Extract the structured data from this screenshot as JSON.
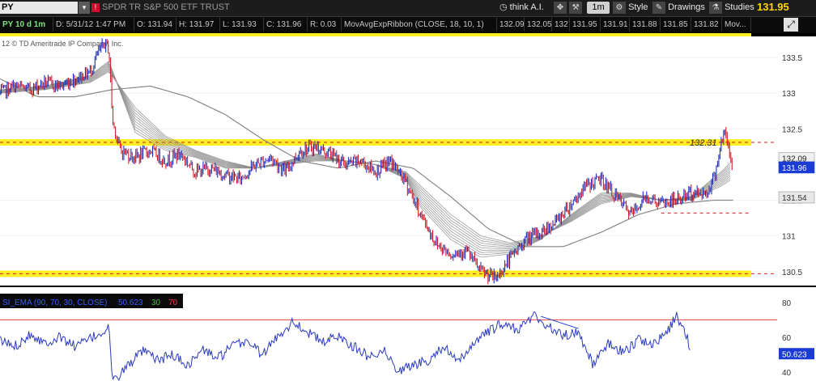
{
  "toolbar": {
    "symbol": "PY",
    "description": "SPDR TR S&P 500 ETF TRUST",
    "think_label": "think A.I.",
    "timeframe": "1m",
    "style_label": "Style",
    "drawings_label": "Drawings",
    "studies_label": "Studies",
    "last_price": "131.95"
  },
  "info": {
    "period": "PY 10 d 1m",
    "date": "D: 5/31/12 1:47 PM",
    "open": "O: 131.94",
    "high": "H: 131.97",
    "low": "L: 131.93",
    "close": "C: 131.96",
    "range": "R: 0.03",
    "study": "MovAvgExpRibbon (CLOSE, 18, 10, 1)",
    "ribbon_values": [
      "132.09",
      "132.05",
      "132",
      "131.95",
      "131.91",
      "131.88",
      "131.85",
      "131.82"
    ],
    "more": "Mov..."
  },
  "colors": {
    "background": "#000000",
    "price_panel": "#ffffff",
    "candle_up": "#1f2fb8",
    "candle_down": "#d21e2e",
    "ribbon": "#8c8c8c",
    "support_band": "#ffee22",
    "dashed_line": "#d22020",
    "rsi_line": "#2a3ac0",
    "rsi_bounds": "#e04040"
  },
  "chart_data": [
    {
      "type": "line",
      "panel": "price",
      "copyright": "12 © TD Ameritrade IP Company, Inc.",
      "ylim": [
        130.35,
        133.75
      ],
      "y_ticks": [
        133.5,
        133,
        132.5,
        131.5,
        131,
        130.5
      ],
      "y_tick_labels": [
        "133.5",
        "133",
        "132.5",
        "131.5",
        "131",
        "130.5"
      ],
      "annotation": "132.31",
      "right_labels": [
        "132.09",
        "131.96",
        "131.54"
      ],
      "levels": [
        {
          "name": "resistance",
          "y": 132.31,
          "style": "yellow-band"
        },
        {
          "name": "support",
          "y": 130.47,
          "style": "yellow-band"
        },
        {
          "name": "dash",
          "y": 131.32,
          "style": "dashed",
          "x_from": 0.88
        }
      ],
      "series": [
        {
          "kind": "price",
          "x": [
            0,
            0.02,
            0.04,
            0.06,
            0.08,
            0.1,
            0.12,
            0.13,
            0.14,
            0.145,
            0.15,
            0.16,
            0.18,
            0.2,
            0.22,
            0.24,
            0.26,
            0.28,
            0.3,
            0.32,
            0.34,
            0.36,
            0.38,
            0.4,
            0.42,
            0.44,
            0.46,
            0.48,
            0.5,
            0.52,
            0.54,
            0.56,
            0.58,
            0.6,
            0.62,
            0.64,
            0.66,
            0.68,
            0.7,
            0.72,
            0.74,
            0.76,
            0.78,
            0.8,
            0.82,
            0.84,
            0.86,
            0.88,
            0.9,
            0.92,
            0.94,
            0.95,
            0.96,
            0.965,
            0.97,
            0.975
          ],
          "y": [
            133.0,
            133.1,
            133.05,
            133.15,
            133.1,
            133.2,
            133.3,
            133.55,
            133.7,
            133.6,
            132.6,
            132.2,
            132.1,
            132.2,
            132.05,
            132.15,
            131.9,
            131.95,
            131.85,
            131.8,
            132.0,
            132.1,
            131.9,
            132.2,
            132.25,
            132.15,
            132.0,
            132.05,
            131.9,
            132.05,
            131.75,
            131.3,
            130.9,
            130.75,
            130.8,
            130.5,
            130.4,
            130.7,
            130.95,
            131.05,
            131.2,
            131.45,
            131.7,
            131.8,
            131.55,
            131.3,
            131.55,
            131.45,
            131.5,
            131.6,
            131.6,
            131.8,
            132.3,
            132.45,
            132.2,
            131.96
          ]
        },
        {
          "kind": "ribbon-fast",
          "x": [
            0,
            0.06,
            0.12,
            0.145,
            0.18,
            0.22,
            0.26,
            0.3,
            0.34,
            0.38,
            0.42,
            0.46,
            0.5,
            0.54,
            0.56,
            0.6,
            0.64,
            0.68,
            0.72,
            0.76,
            0.8,
            0.84,
            0.88,
            0.92,
            0.96,
            0.975
          ],
          "y": [
            133.05,
            133.1,
            133.25,
            133.45,
            132.45,
            132.2,
            132.1,
            131.95,
            131.95,
            132.05,
            132.15,
            132.05,
            132.0,
            131.8,
            131.4,
            130.95,
            130.7,
            130.75,
            130.95,
            131.3,
            131.6,
            131.6,
            131.5,
            131.55,
            131.9,
            132.05
          ]
        },
        {
          "kind": "ribbon-slow",
          "x": [
            0,
            0.06,
            0.12,
            0.145,
            0.18,
            0.22,
            0.26,
            0.3,
            0.34,
            0.38,
            0.42,
            0.46,
            0.5,
            0.54,
            0.56,
            0.6,
            0.64,
            0.68,
            0.72,
            0.76,
            0.8,
            0.84,
            0.88,
            0.92,
            0.96,
            0.975
          ],
          "y": [
            133.0,
            133.05,
            133.15,
            133.3,
            132.8,
            132.4,
            132.2,
            132.05,
            131.95,
            132.0,
            132.05,
            132.05,
            132.0,
            131.9,
            131.7,
            131.3,
            131.0,
            130.9,
            131.0,
            131.2,
            131.45,
            131.55,
            131.5,
            131.5,
            131.7,
            131.8
          ]
        },
        {
          "kind": "long-ma",
          "x": [
            0,
            0.05,
            0.1,
            0.15,
            0.2,
            0.25,
            0.3,
            0.35,
            0.4,
            0.45,
            0.5,
            0.55,
            0.6,
            0.65,
            0.7,
            0.75,
            0.8,
            0.85,
            0.9,
            0.95,
            0.98
          ],
          "y": [
            133.2,
            132.95,
            132.95,
            133.05,
            133.1,
            132.95,
            132.7,
            132.35,
            132.05,
            131.95,
            132.05,
            131.95,
            131.55,
            131.1,
            130.85,
            130.85,
            131.05,
            131.3,
            131.45,
            131.5,
            131.5
          ]
        }
      ]
    },
    {
      "type": "line",
      "panel": "indicator",
      "label": "SI_EMA (90, 70, 30, CLOSE)",
      "value_label": "50.623",
      "level_30": "30",
      "level_70": "70",
      "ylim": [
        35,
        85
      ],
      "y_ticks": [
        80,
        60,
        40
      ],
      "y_tick_labels": [
        "80",
        "60",
        "40"
      ],
      "levels": [
        70,
        30
      ],
      "last_value": "50.623",
      "trendline": {
        "x": [
          0.72,
          0.77
        ],
        "y": [
          72,
          65
        ]
      },
      "series": [
        {
          "name": "SI_EMA",
          "x": [
            0,
            0.02,
            0.04,
            0.06,
            0.08,
            0.1,
            0.12,
            0.14,
            0.145,
            0.15,
            0.17,
            0.19,
            0.21,
            0.23,
            0.25,
            0.27,
            0.29,
            0.31,
            0.33,
            0.35,
            0.37,
            0.39,
            0.41,
            0.43,
            0.45,
            0.47,
            0.49,
            0.51,
            0.53,
            0.55,
            0.57,
            0.59,
            0.61,
            0.63,
            0.65,
            0.67,
            0.69,
            0.71,
            0.73,
            0.75,
            0.77,
            0.79,
            0.81,
            0.83,
            0.85,
            0.87,
            0.89,
            0.9,
            0.91,
            0.92
          ],
          "y": [
            58,
            55,
            62,
            57,
            60,
            55,
            59,
            64,
            66,
            34,
            44,
            52,
            47,
            50,
            44,
            53,
            48,
            55,
            58,
            50,
            61,
            69,
            63,
            57,
            61,
            55,
            49,
            53,
            41,
            44,
            47,
            55,
            45,
            57,
            63,
            68,
            64,
            73,
            66,
            61,
            63,
            44,
            57,
            51,
            59,
            56,
            64,
            72,
            66,
            52
          ]
        }
      ]
    }
  ]
}
